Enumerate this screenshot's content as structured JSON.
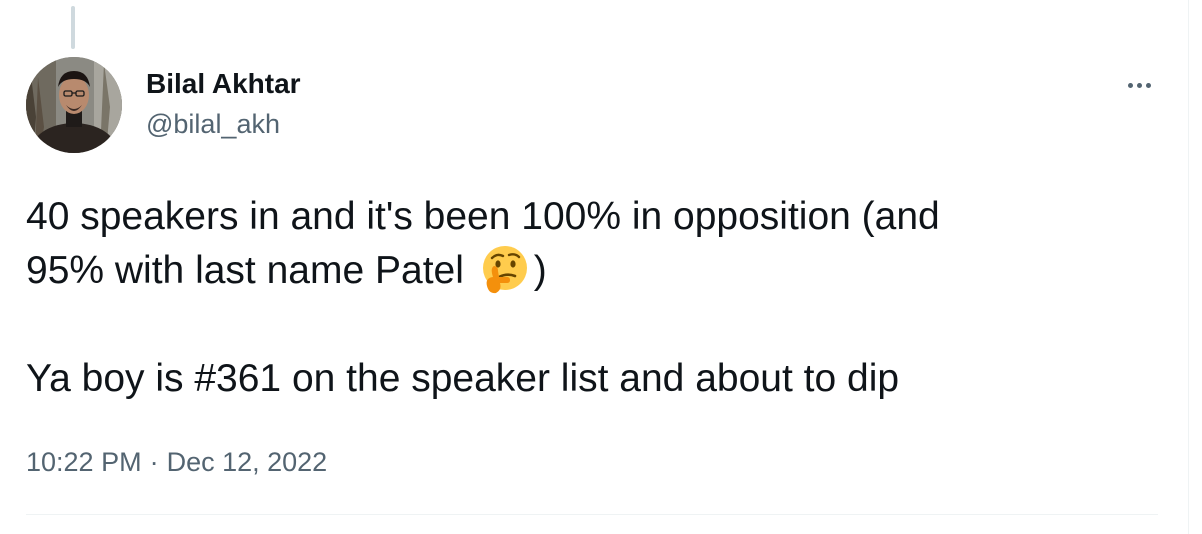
{
  "author": {
    "display_name": "Bilal Akhtar",
    "handle": "@bilal_akh"
  },
  "tweet": {
    "line1": "40 speakers in and it's been 100% in opposition (and",
    "line2_before_emoji": "95% with last name Patel ",
    "emoji": "thinking-face-icon",
    "line2_after_emoji": ")",
    "line3": "Ya boy is #361 on the speaker list and about to dip"
  },
  "meta": {
    "time": "10:22 PM",
    "separator": "·",
    "date": "Dec 12, 2022"
  },
  "icons": {
    "more": "more-horizontal-icon"
  },
  "colors": {
    "text_primary": "#0f1419",
    "text_secondary": "#536471",
    "divider": "#eff3f4",
    "thread_line": "#cfd9de"
  }
}
